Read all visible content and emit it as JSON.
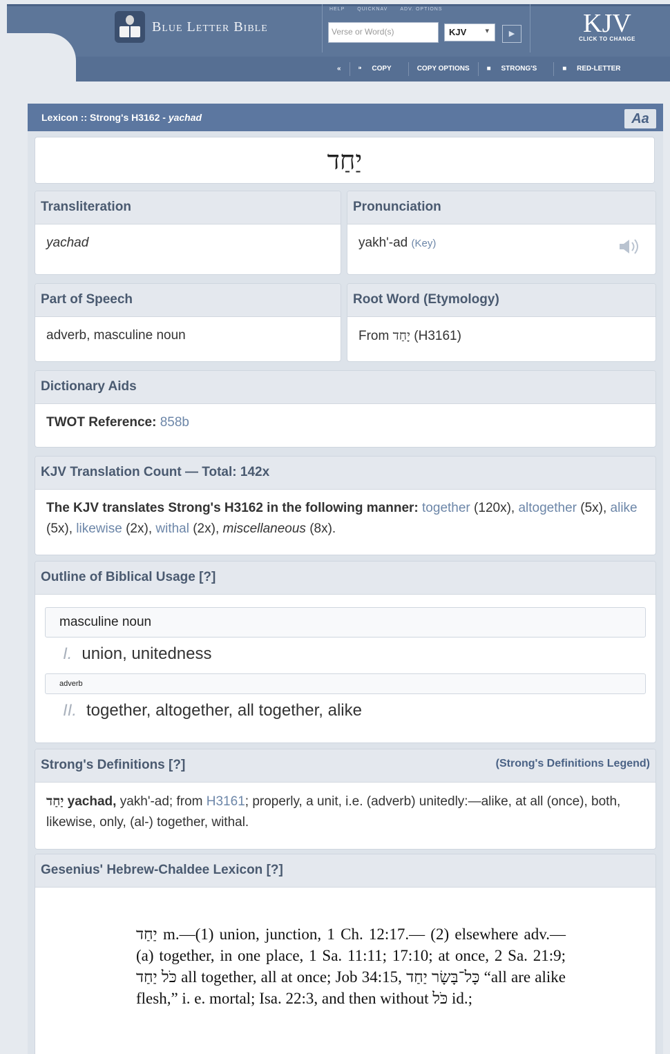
{
  "header": {
    "logo_text": "Blue Letter Bible",
    "search_tabs": [
      "HELP",
      "QUICKNAV",
      "ADV. OPTIONS"
    ],
    "search_placeholder": "Verse or Word(s)",
    "version_selected": "KJV",
    "version_badge": "KJV",
    "version_badge_sub": "CLICK TO CHANGE",
    "tools": {
      "copy": "COPY",
      "copy_options": "COPY OPTIONS",
      "strongs": "STRONG'S",
      "red_letter": "RED-LETTER"
    }
  },
  "lexicon": {
    "title_prefix": "Lexicon :: Strong's H3162 - ",
    "title_word": "yachad",
    "font_button": "Aa",
    "hebrew": "יַחַד",
    "transliteration": {
      "label": "Transliteration",
      "value": "yachad"
    },
    "pronunciation": {
      "label": "Pronunciation",
      "value": "yakh'-ad",
      "key": "(Key)"
    },
    "part_of_speech": {
      "label": "Part of Speech",
      "value": "adverb, masculine noun"
    },
    "root_word": {
      "label": "Root Word (Etymology)",
      "prefix": "From",
      "hebrew": "יָחַד",
      "ref": "(H3161)"
    },
    "dictionary_aids": {
      "label": "Dictionary Aids",
      "twot_label": "TWOT Reference:",
      "twot_value": "858b"
    },
    "translation_count": {
      "label": "KJV Translation Count — Total: 142x",
      "intro": "The KJV translates Strong's H3162 in the following manner:",
      "items": [
        {
          "word": "together",
          "count": "(120x),"
        },
        {
          "word": "altogether",
          "count": "(5x),"
        },
        {
          "word": "alike",
          "count": "(5x),"
        },
        {
          "word": "likewise",
          "count": "(2x),"
        },
        {
          "word": "withal",
          "count": "(2x),"
        },
        {
          "word": "miscellaneous",
          "count": "(8x)."
        }
      ]
    },
    "outline": {
      "label": "Outline of Biblical Usage [?]",
      "groups": [
        {
          "pos": "masculine noun",
          "num": "I.",
          "text": "union, unitedness"
        },
        {
          "pos": "adverb",
          "num": "II.",
          "text": "together, altogether, all together, alike"
        }
      ]
    },
    "strongs_definitions": {
      "label": "Strong's Definitions [?]",
      "legend": "(Strong's Definitions Legend)",
      "hebrew": "יַחַד",
      "word": "yachad,",
      "text1": " yakh'-ad; from ",
      "ref": "H3161",
      "text2": "; properly, a unit, i.e. (adverb) unitedly:—alike, at all (once), both, likewise, only, (al-) together, withal."
    },
    "gesenius": {
      "label": "Gesenius' Hebrew-Chaldee Lexicon [?]",
      "text": "יַחַד m.—(1) union, junction, 1 Ch. 12:17.— (2) elsewhere adv.—(a) together, in one place, 1 Sa. 11:11; 17:10; at once, 2 Sa. 21:9; כֹּל יַחַד all together, all at once; Job 34:15, כָּל־בָּשָׂר יַחַד “all are alike flesh,” i. e. mortal; Isa. 22:3, and then without כֹּל id.;"
    }
  }
}
